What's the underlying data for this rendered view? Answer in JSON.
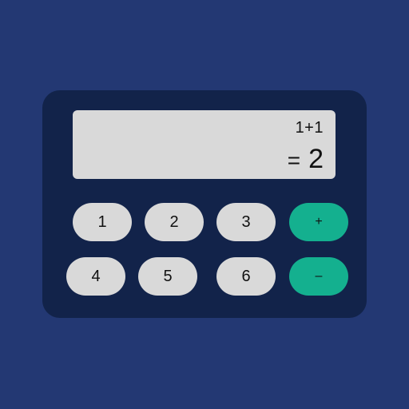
{
  "display": {
    "expression": "1+1",
    "equals_sign": "=",
    "result": "2"
  },
  "keys": {
    "one": "1",
    "two": "2",
    "three": "3",
    "plus": "+",
    "four": "4",
    "five": "5",
    "six": "6",
    "minus": "–"
  },
  "colors": {
    "background": "#233873",
    "calculator_body": "#12234a",
    "display": "#d9d9d9",
    "number_key": "#d9d9d9",
    "operator_key": "#14b08f"
  }
}
